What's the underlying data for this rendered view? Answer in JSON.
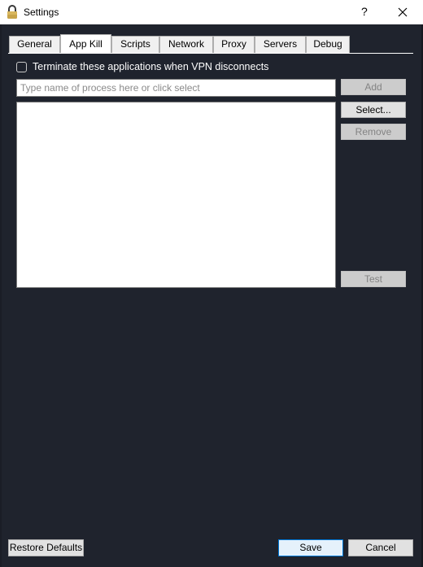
{
  "window": {
    "title": "Settings",
    "help_label": "?",
    "lock_icon": "lock-icon",
    "close_icon": "close-icon"
  },
  "tabs": [
    {
      "label": "General",
      "active": false
    },
    {
      "label": "App Kill",
      "active": true
    },
    {
      "label": "Scripts",
      "active": false
    },
    {
      "label": "Network",
      "active": false
    },
    {
      "label": "Proxy",
      "active": false
    },
    {
      "label": "Servers",
      "active": false
    },
    {
      "label": "Debug",
      "active": false
    }
  ],
  "app_kill": {
    "terminate_label": "Terminate these applications when VPN disconnects",
    "terminate_checked": false,
    "process_input_value": "",
    "process_input_placeholder": "Type name of process here or click select",
    "processes": [],
    "add_label": "Add",
    "select_label": "Select...",
    "remove_label": "Remove",
    "test_label": "Test"
  },
  "footer": {
    "restore_label": "Restore Defaults",
    "save_label": "Save",
    "cancel_label": "Cancel"
  },
  "colors": {
    "background": "#1f232d",
    "titlebar": "#ffffff",
    "accent": "#0078d7"
  }
}
